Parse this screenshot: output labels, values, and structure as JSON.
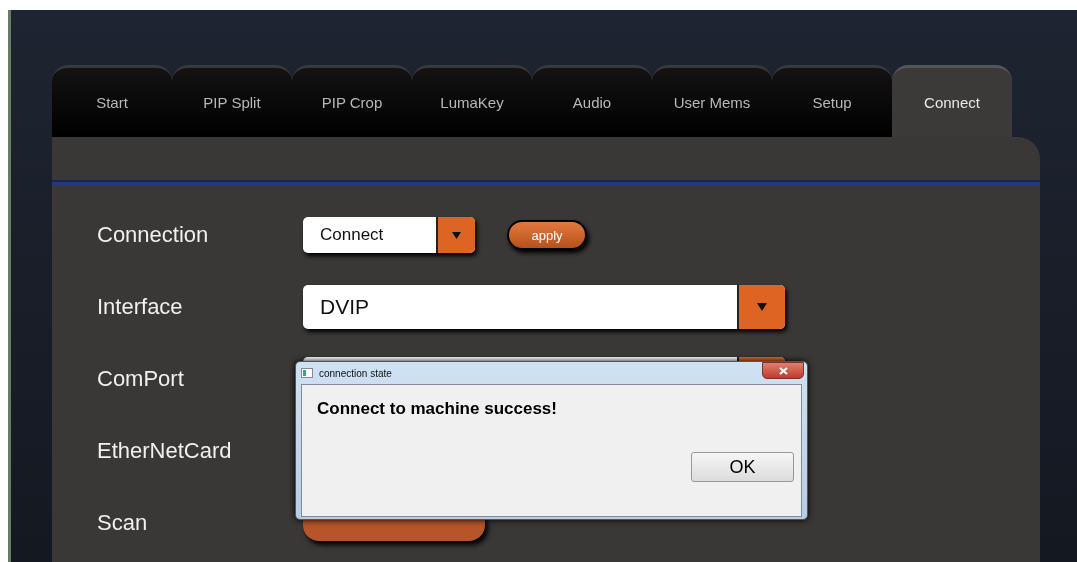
{
  "tabs": [
    {
      "label": "Start",
      "selected": false
    },
    {
      "label": "PIP Split",
      "selected": false
    },
    {
      "label": "PIP Crop",
      "selected": false
    },
    {
      "label": "LumaKey",
      "selected": false
    },
    {
      "label": "Audio",
      "selected": false
    },
    {
      "label": "User Mems",
      "selected": false
    },
    {
      "label": "Setup",
      "selected": false
    },
    {
      "label": "Connect",
      "selected": true
    }
  ],
  "rows": [
    {
      "label": "Connection",
      "kind": "select-apply",
      "value": "Connect",
      "button": "apply"
    },
    {
      "label": "Interface",
      "kind": "select-wide",
      "value": "DVIP"
    },
    {
      "label": "ComPort",
      "kind": "select-wide"
    },
    {
      "label": "EtherNetCard",
      "kind": "hidden"
    },
    {
      "label": "Scan",
      "kind": "button"
    }
  ],
  "dialog": {
    "title": "connection state",
    "message": "Connect to machine success!",
    "button": "OK"
  }
}
